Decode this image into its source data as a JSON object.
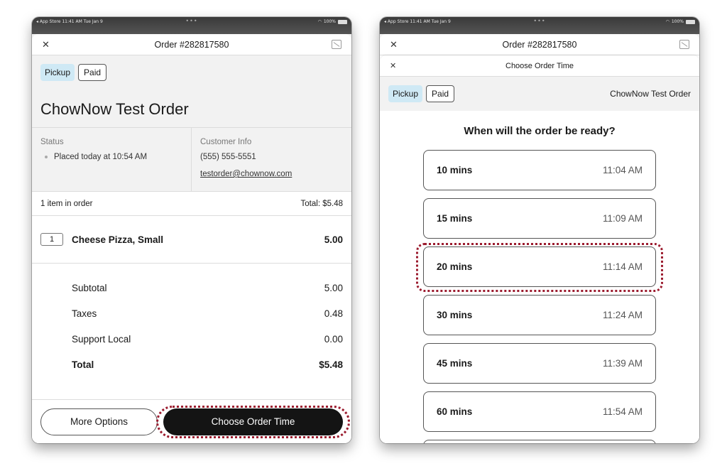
{
  "status_bar": {
    "left": "◂ App Store  11:41 AM  Tue Jan 9",
    "dots": "•••",
    "battery": "100%"
  },
  "left_panel": {
    "nav_title": "Order #282817580",
    "badges": {
      "pickup": "Pickup",
      "paid": "Paid"
    },
    "order_title": "ChowNow Test Order",
    "status": {
      "label": "Status",
      "item": "Placed today at 10:54 AM"
    },
    "customer": {
      "label": "Customer Info",
      "phone": "(555) 555-5551",
      "email": "testorder@chownow.com"
    },
    "summary": {
      "count": "1 item in order",
      "total": "Total: $5.48"
    },
    "item": {
      "qty": "1",
      "name": "Cheese Pizza, Small",
      "price": "5.00"
    },
    "totals": [
      {
        "label": "Subtotal",
        "value": "5.00"
      },
      {
        "label": "Taxes",
        "value": "0.48"
      },
      {
        "label": "Support Local",
        "value": "0.00"
      },
      {
        "label": "Total",
        "value": "$5.48"
      }
    ],
    "buttons": {
      "more": "More Options",
      "choose": "Choose Order Time"
    }
  },
  "right_panel": {
    "nav_title": "Order #282817580",
    "sub_title": "Choose Order Time",
    "badges": {
      "pickup": "Pickup",
      "paid": "Paid"
    },
    "order_name": "ChowNow Test Order",
    "question": "When will the order be ready?",
    "options": [
      {
        "mins": "10 mins",
        "time": "11:04 AM"
      },
      {
        "mins": "15 mins",
        "time": "11:09 AM"
      },
      {
        "mins": "20 mins",
        "time": "11:14 AM"
      },
      {
        "mins": "30 mins",
        "time": "11:24 AM"
      },
      {
        "mins": "45 mins",
        "time": "11:39 AM"
      },
      {
        "mins": "60 mins",
        "time": "11:54 AM"
      }
    ]
  },
  "colors": {
    "highlight": "#9b1b2e",
    "pickup_badge": "#cfe9f5",
    "primary_button": "#141414"
  }
}
